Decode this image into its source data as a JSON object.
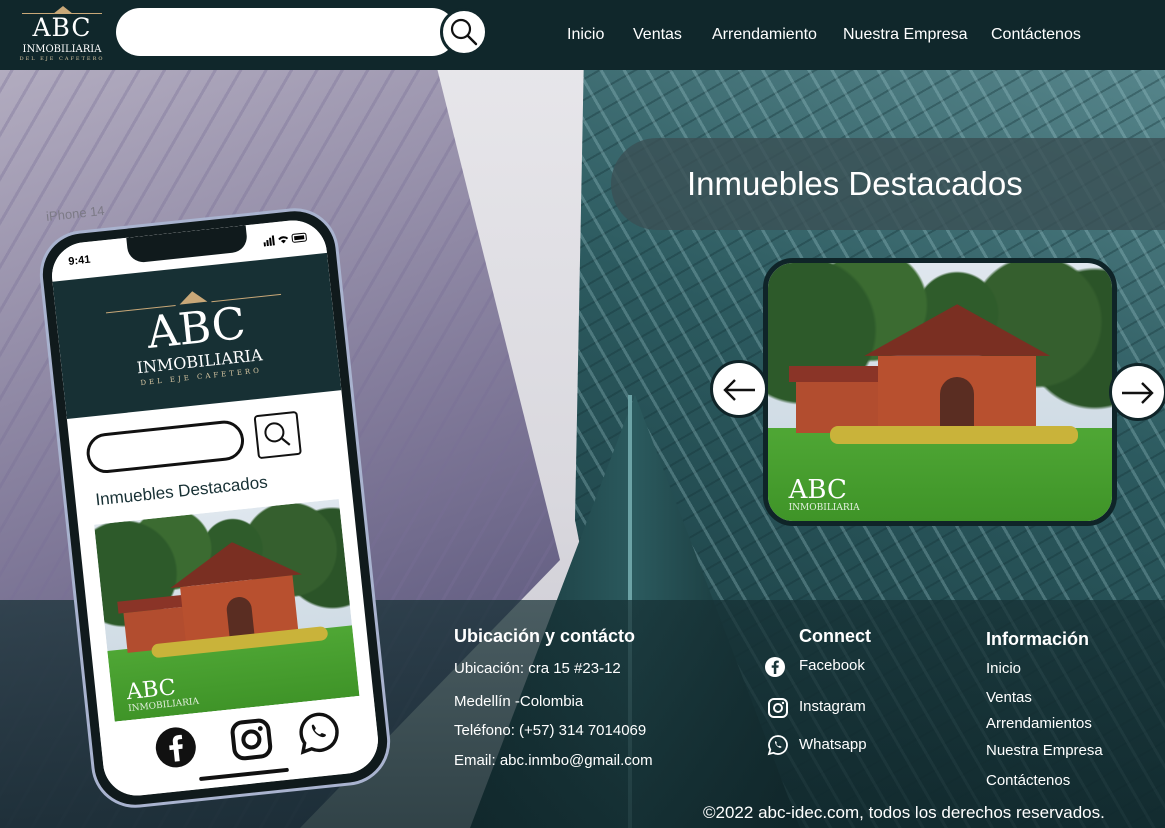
{
  "header": {
    "logo": {
      "abc": "ABC",
      "inmobiliaria": "INMOBILIARIA",
      "tagline": "DEL EJE CAFETERO"
    },
    "search": {
      "value": "",
      "placeholder": ""
    },
    "nav": [
      "Inicio",
      "Ventas",
      "Arrendamiento",
      "Nuestra Empresa",
      "Contáctenos"
    ]
  },
  "featured": {
    "title": "Inmuebles Destacados",
    "image_watermark": {
      "abc": "ABC",
      "inmobiliaria": "INMOBILIARIA"
    }
  },
  "phone": {
    "device_label": "iPhone 14",
    "time": "9:41",
    "logo": {
      "abc": "ABC",
      "inmobiliaria": "INMOBILIARIA",
      "tagline": "DEL EJE CAFETERO"
    },
    "title": "Inmuebles Destacados",
    "image_watermark": {
      "abc": "ABC",
      "inmobiliaria": "INMOBILIARIA"
    }
  },
  "footer": {
    "location": {
      "heading": "Ubicación y contácto",
      "address": "Ubicación: cra 15 #23-12",
      "city": "Medellín -Colombia",
      "phone": "Teléfono: (+57) 314 7014069",
      "email": "Email: abc.inmbo@gmail.com"
    },
    "connect": {
      "heading": "Connect",
      "items": [
        "Facebook",
        "Instagram",
        "Whatsapp"
      ]
    },
    "info": {
      "heading": "Información",
      "items": [
        "Inicio",
        "Ventas",
        "Arrendamientos",
        "Nuestra Empresa",
        "Contáctenos"
      ]
    },
    "copyright": "©2022 abc-idec.com, todos los derechos reservados."
  },
  "colors": {
    "primary": "#10272b",
    "gold": "#c9a878",
    "panel": "#3a5055"
  }
}
